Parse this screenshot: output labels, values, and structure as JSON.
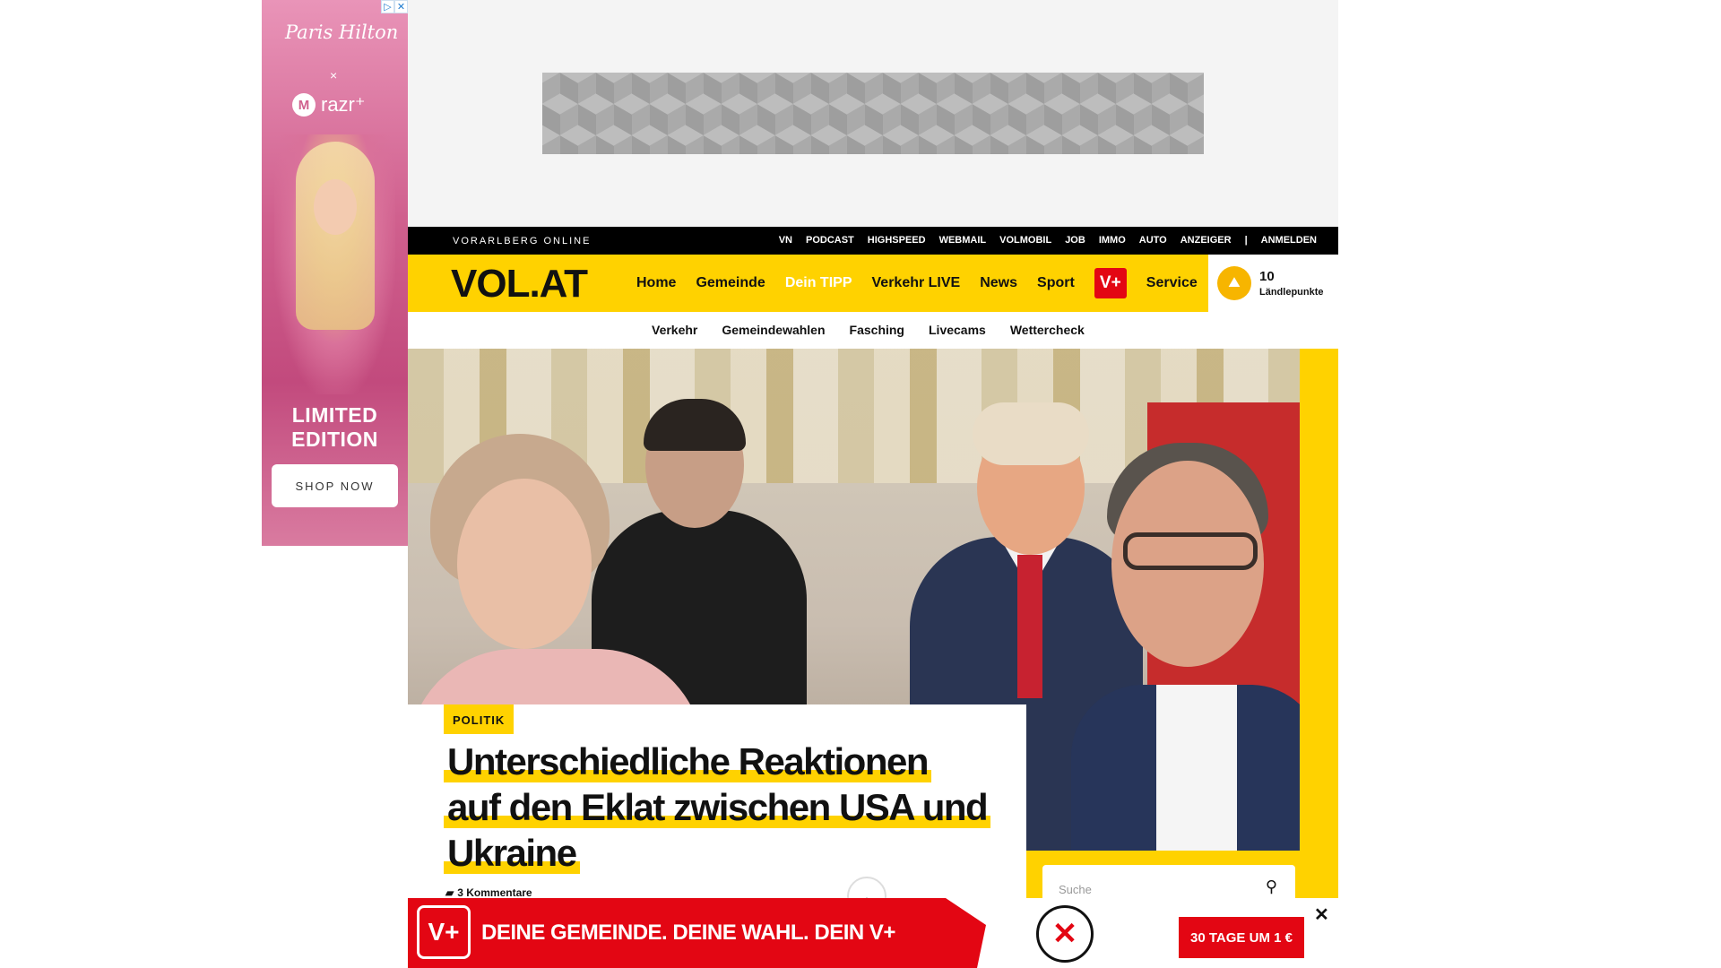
{
  "left_ad": {
    "adchoices": [
      "▷",
      "✕"
    ],
    "brand_script": "Paris Hilton",
    "cross": "×",
    "moto_logo": "M",
    "product": "razr⁺",
    "headline_line1": "LIMITED",
    "headline_line2": "EDITION",
    "cta": "SHOP NOW"
  },
  "topbar": {
    "brand": "VORARLBERG ONLINE",
    "links": [
      "VN",
      "PODCAST",
      "HIGHSPEED",
      "WEBMAIL",
      "VOLMOBIL",
      "JOB",
      "IMMO",
      "AUTO",
      "ANZEIGER",
      "|",
      "ANMELDEN"
    ]
  },
  "header": {
    "logo": "VOL.AT",
    "nav": [
      "Home",
      "Gemeinde",
      "Dein TIPP",
      "Verkehr LIVE",
      "News",
      "Sport"
    ],
    "vplus": "V+",
    "service": "Service",
    "points_value": "10",
    "points_label": "Ländlepunkte",
    "points_icon": "mountain-icon"
  },
  "subnav": [
    "Verkehr",
    "Gemeindewahlen",
    "Fasching",
    "Livecams",
    "Wettercheck"
  ],
  "article": {
    "category": "POLITIK",
    "headline_lines": [
      "Unterschiedliche Reaktionen",
      "auf den Eklat zwischen USA und",
      "Ukraine"
    ],
    "comments_icon": "comment-icon",
    "comments": "3 Kommentare"
  },
  "search": {
    "placeholder": "Suche",
    "icon": "⚲"
  },
  "scroll_up_icon": "︿",
  "bottom_ad": {
    "logo": "V+",
    "slogan": "DEINE GEMEINDE. DEINE WAHL. DEIN V+",
    "ballot_mark": "✕",
    "cta": "30 TAGE UM 1 €",
    "close": "✕"
  },
  "colors": {
    "accent_yellow": "#ffd200",
    "vplus_red": "#e30613"
  }
}
